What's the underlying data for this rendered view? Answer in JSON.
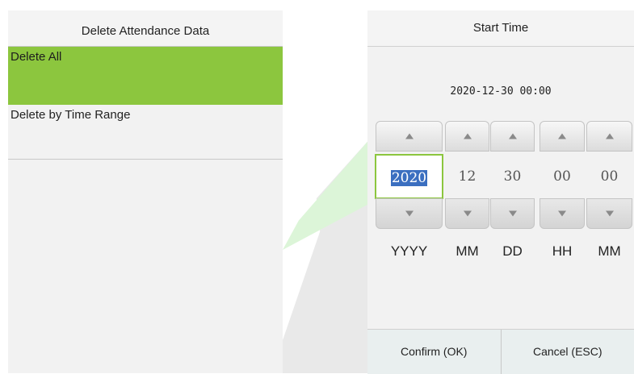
{
  "left": {
    "title": "Delete Attendance Data",
    "items": [
      {
        "label": "Delete All",
        "selected": true
      },
      {
        "label": "Delete by Time Range",
        "selected": false
      }
    ]
  },
  "right": {
    "title": "Start Time",
    "datetime": "2020-12-30 00:00",
    "fields": [
      {
        "value": "2020",
        "unit": "YYYY",
        "focused": true
      },
      {
        "value": "12",
        "unit": "MM"
      },
      {
        "value": "30",
        "unit": "DD"
      },
      {
        "value": "00",
        "unit": "HH"
      },
      {
        "value": "00",
        "unit": "MM"
      }
    ],
    "confirm_label": "Confirm (OK)",
    "cancel_label": "Cancel (ESC)"
  },
  "colors": {
    "accent": "#8cc63e",
    "selection": "#3b6fc0"
  },
  "icons": {
    "increment": "triangle-up-icon",
    "decrement": "triangle-down-icon"
  }
}
